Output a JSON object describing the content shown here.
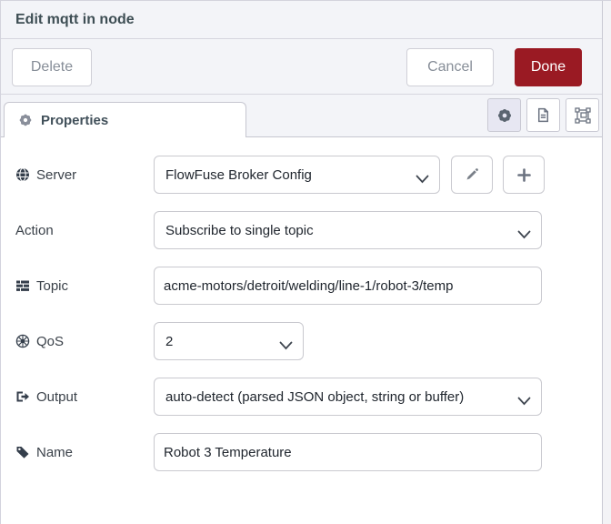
{
  "window": {
    "title": "Edit mqtt in node"
  },
  "buttons": {
    "delete": "Delete",
    "cancel": "Cancel",
    "done": "Done"
  },
  "tab": {
    "label": "Properties"
  },
  "toolbar": {
    "properties_icon": "gear",
    "description_icon": "document",
    "appearance_icon": "selection-box",
    "selected": "properties"
  },
  "form": {
    "server": {
      "label": "Server",
      "icon": "globe",
      "value": "FlowFuse Broker Config"
    },
    "action": {
      "label": "Action",
      "value": "Subscribe to single topic"
    },
    "topic": {
      "label": "Topic",
      "icon": "tasks",
      "value": "acme-motors/detroit/welding/line-1/robot-3/temp"
    },
    "qos": {
      "label": "QoS",
      "icon": "empire",
      "value": "2"
    },
    "output": {
      "label": "Output",
      "icon": "sign-out",
      "value": "auto-detect (parsed JSON object, string or buffer)"
    },
    "name": {
      "label": "Name",
      "icon": "tag",
      "value": "Robot 3 Temperature"
    }
  },
  "colors": {
    "done_bg": "#9a1a23",
    "header_bg": "#f3f4f8",
    "selected_tool_bg": "#e7e7f2",
    "border": "#c9c9cf"
  }
}
